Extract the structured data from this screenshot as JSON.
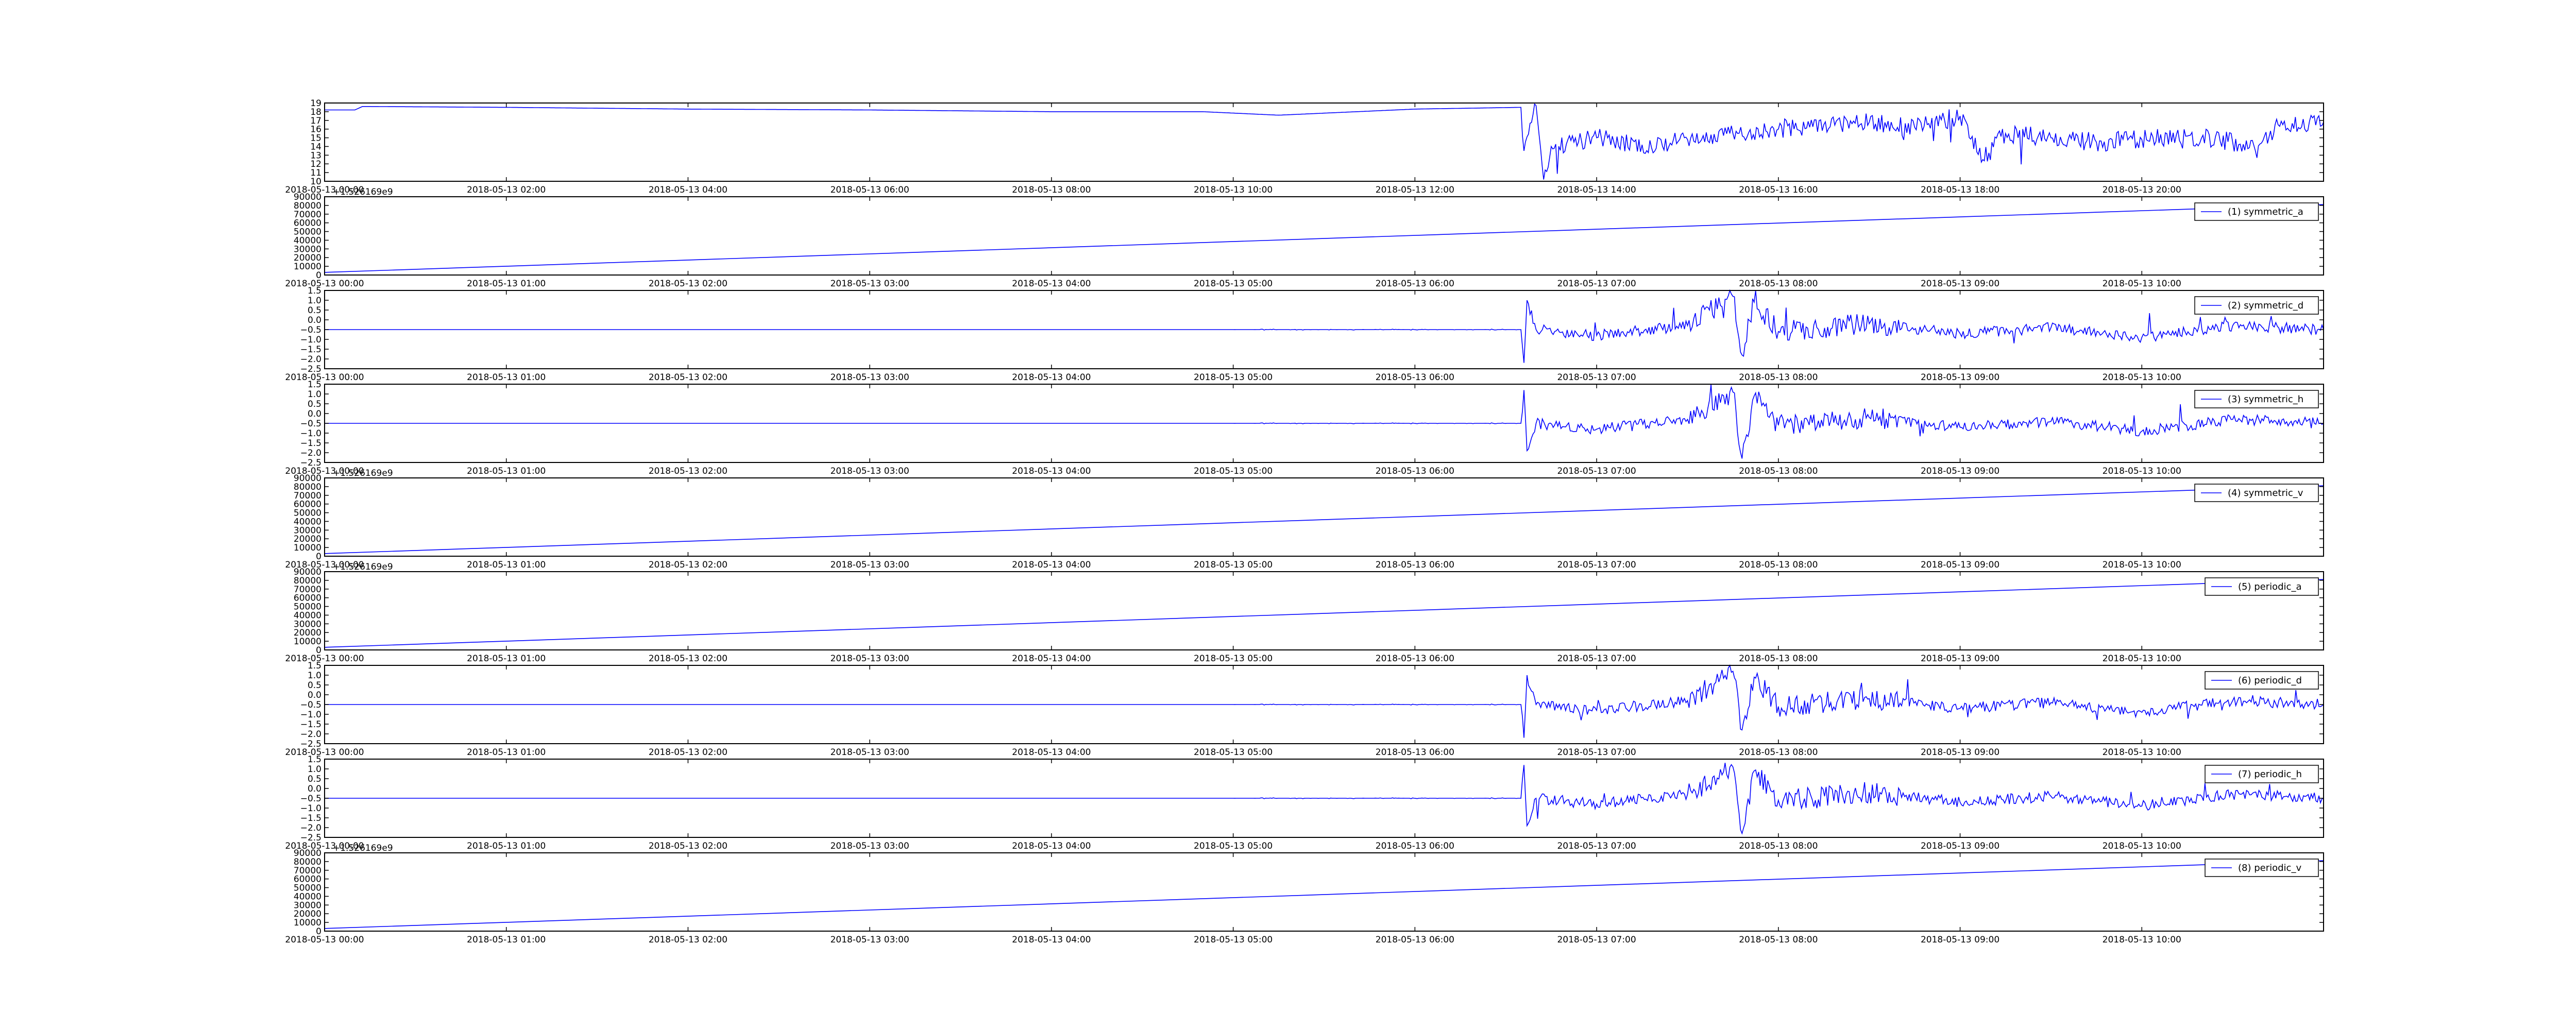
{
  "colors": {
    "line": "#0000ff",
    "axes": "#000000",
    "background": "#ffffff"
  },
  "chart_data": [
    {
      "type": "line",
      "x_tick_labels": [
        "2018-05-13 00:00",
        "2018-05-13 02:00",
        "2018-05-13 04:00",
        "2018-05-13 06:00",
        "2018-05-13 08:00",
        "2018-05-13 10:00",
        "2018-05-13 12:00",
        "2018-05-13 14:00",
        "2018-05-13 16:00",
        "2018-05-13 18:00",
        "2018-05-13 20:00"
      ],
      "x_range": [
        "2018-05-13 00:00",
        "2018-05-13 22:00"
      ],
      "y_tick_labels": [
        "10",
        "11",
        "12",
        "13",
        "14",
        "15",
        "16",
        "17",
        "18",
        "19"
      ],
      "ylim": [
        10,
        19
      ],
      "legend": null,
      "grid": false,
      "series": [
        {
          "x": [
            "2018-05-13 00:00",
            "2018-05-13 00:20",
            "2018-05-13 00:25",
            "2018-05-13 02:00",
            "2018-05-13 04:00",
            "2018-05-13 06:00",
            "2018-05-13 08:00",
            "2018-05-13 09:40",
            "2018-05-13 10:30",
            "2018-05-13 12:00",
            "2018-05-13 13:10",
            "2018-05-13 13:12",
            "2018-05-13 13:20",
            "2018-05-13 13:25",
            "2018-05-13 13:30",
            "2018-05-13 13:45",
            "2018-05-13 14:00",
            "2018-05-13 14:30",
            "2018-05-13 15:00",
            "2018-05-13 15:30",
            "2018-05-13 16:00",
            "2018-05-13 16:30",
            "2018-05-13 17:00",
            "2018-05-13 17:30",
            "2018-05-13 18:00",
            "2018-05-13 18:15",
            "2018-05-13 18:30",
            "2018-05-13 19:00",
            "2018-05-13 19:30",
            "2018-05-13 20:00",
            "2018-05-13 20:30",
            "2018-05-13 21:00",
            "2018-05-13 21:15",
            "2018-05-13 21:30",
            "2018-05-13 22:00"
          ],
          "values": [
            18.2,
            18.2,
            18.6,
            18.5,
            18.3,
            18.2,
            18.0,
            18.0,
            17.6,
            18.3,
            18.5,
            13.5,
            18.7,
            10.2,
            14.0,
            14.5,
            15.0,
            14.2,
            14.8,
            15.5,
            16.0,
            16.5,
            16.8,
            16.2,
            17.5,
            12.5,
            15.5,
            15.0,
            14.5,
            14.8,
            15.2,
            14.5,
            13.5,
            16.5,
            16.8
          ]
        }
      ]
    },
    {
      "type": "line",
      "offset_label": "+1.526169e9",
      "x_tick_labels": [
        "2018-05-13 00:00",
        "2018-05-13 01:00",
        "2018-05-13 02:00",
        "2018-05-13 03:00",
        "2018-05-13 04:00",
        "2018-05-13 05:00",
        "2018-05-13 06:00",
        "2018-05-13 07:00",
        "2018-05-13 08:00",
        "2018-05-13 09:00",
        "2018-05-13 10:00"
      ],
      "x_range": [
        "2018-05-13 00:00",
        "2018-05-13 11:00"
      ],
      "y_tick_labels": [
        "0",
        "10000",
        "20000",
        "30000",
        "40000",
        "50000",
        "60000",
        "70000",
        "80000",
        "90000"
      ],
      "ylim": [
        0,
        90000
      ],
      "legend": "top-right",
      "grid": false,
      "series": [
        {
          "name": "(1) symmetric_a",
          "x": [
            "2018-05-13 00:00",
            "2018-05-13 11:00"
          ],
          "values": [
            3000,
            81000
          ]
        }
      ]
    },
    {
      "type": "line",
      "x_tick_labels": [
        "2018-05-13 00:00",
        "2018-05-13 01:00",
        "2018-05-13 02:00",
        "2018-05-13 03:00",
        "2018-05-13 04:00",
        "2018-05-13 05:00",
        "2018-05-13 06:00",
        "2018-05-13 07:00",
        "2018-05-13 08:00",
        "2018-05-13 09:00",
        "2018-05-13 10:00"
      ],
      "x_range": [
        "2018-05-13 00:00",
        "2018-05-13 11:00"
      ],
      "y_tick_labels": [
        "−2.5",
        "−2.0",
        "−1.5",
        "−1.0",
        "−0.5",
        "0.0",
        "0.5",
        "1.0",
        "1.5"
      ],
      "ylim": [
        -2.5,
        1.5
      ],
      "legend": "top-right",
      "grid": false,
      "series": [
        {
          "name": "(2) symmetric_d",
          "x": [
            "2018-05-13 00:00",
            "2018-05-13 05:00",
            "2018-05-13 06:35",
            "2018-05-13 06:36",
            "2018-05-13 06:37",
            "2018-05-13 06:40",
            "2018-05-13 07:00",
            "2018-05-13 07:30",
            "2018-05-13 07:45",
            "2018-05-13 07:48",
            "2018-05-13 07:52",
            "2018-05-13 08:00",
            "2018-05-13 08:30",
            "2018-05-13 09:00",
            "2018-05-13 09:30",
            "2018-05-13 10:00",
            "2018-05-13 10:30",
            "2018-05-13 11:00"
          ],
          "values": [
            -0.5,
            -0.5,
            -0.5,
            -2.2,
            1.0,
            -0.5,
            -0.8,
            -0.3,
            1.2,
            -1.8,
            0.9,
            -0.6,
            -0.2,
            -0.7,
            -0.4,
            -0.9,
            -0.3,
            -0.5
          ]
        }
      ]
    },
    {
      "type": "line",
      "x_tick_labels": [
        "2018-05-13 00:00",
        "2018-05-13 01:00",
        "2018-05-13 02:00",
        "2018-05-13 03:00",
        "2018-05-13 04:00",
        "2018-05-13 05:00",
        "2018-05-13 06:00",
        "2018-05-13 07:00",
        "2018-05-13 08:00",
        "2018-05-13 09:00",
        "2018-05-13 10:00"
      ],
      "x_range": [
        "2018-05-13 00:00",
        "2018-05-13 11:00"
      ],
      "y_tick_labels": [
        "−2.5",
        "−2.0",
        "−1.5",
        "−1.0",
        "−0.5",
        "0.0",
        "0.5",
        "1.0",
        "1.5"
      ],
      "ylim": [
        -2.5,
        1.5
      ],
      "legend": "top-right",
      "grid": false,
      "series": [
        {
          "name": "(3) symmetric_h",
          "x": [
            "2018-05-13 00:00",
            "2018-05-13 05:00",
            "2018-05-13 06:35",
            "2018-05-13 06:36",
            "2018-05-13 06:37",
            "2018-05-13 06:40",
            "2018-05-13 07:00",
            "2018-05-13 07:30",
            "2018-05-13 07:45",
            "2018-05-13 07:48",
            "2018-05-13 07:52",
            "2018-05-13 08:00",
            "2018-05-13 08:30",
            "2018-05-13 09:00",
            "2018-05-13 09:30",
            "2018-05-13 10:00",
            "2018-05-13 10:30",
            "2018-05-13 11:00"
          ],
          "values": [
            -0.5,
            -0.5,
            -0.5,
            1.2,
            -1.9,
            -0.5,
            -0.8,
            -0.3,
            1.1,
            -2.3,
            0.9,
            -0.6,
            -0.2,
            -0.7,
            -0.4,
            -0.9,
            -0.3,
            -0.5
          ]
        }
      ]
    },
    {
      "type": "line",
      "offset_label": "+1.526169e9",
      "x_tick_labels": [
        "2018-05-13 00:00",
        "2018-05-13 01:00",
        "2018-05-13 02:00",
        "2018-05-13 03:00",
        "2018-05-13 04:00",
        "2018-05-13 05:00",
        "2018-05-13 06:00",
        "2018-05-13 07:00",
        "2018-05-13 08:00",
        "2018-05-13 09:00",
        "2018-05-13 10:00"
      ],
      "x_range": [
        "2018-05-13 00:00",
        "2018-05-13 11:00"
      ],
      "y_tick_labels": [
        "0",
        "10000",
        "20000",
        "30000",
        "40000",
        "50000",
        "60000",
        "70000",
        "80000",
        "90000"
      ],
      "ylim": [
        0,
        90000
      ],
      "legend": "top-right",
      "grid": false,
      "series": [
        {
          "name": "(4) symmetric_v",
          "x": [
            "2018-05-13 00:00",
            "2018-05-13 11:00"
          ],
          "values": [
            3000,
            81000
          ]
        }
      ]
    },
    {
      "type": "line",
      "offset_label": "+1.526169e9",
      "x_tick_labels": [
        "2018-05-13 00:00",
        "2018-05-13 01:00",
        "2018-05-13 02:00",
        "2018-05-13 03:00",
        "2018-05-13 04:00",
        "2018-05-13 05:00",
        "2018-05-13 06:00",
        "2018-05-13 07:00",
        "2018-05-13 08:00",
        "2018-05-13 09:00",
        "2018-05-13 10:00"
      ],
      "x_range": [
        "2018-05-13 00:00",
        "2018-05-13 11:00"
      ],
      "y_tick_labels": [
        "0",
        "10000",
        "20000",
        "30000",
        "40000",
        "50000",
        "60000",
        "70000",
        "80000",
        "90000"
      ],
      "ylim": [
        0,
        90000
      ],
      "legend": "top-right",
      "grid": false,
      "series": [
        {
          "name": "(5) periodic_a",
          "x": [
            "2018-05-13 00:00",
            "2018-05-13 11:00"
          ],
          "values": [
            3000,
            81000
          ]
        }
      ]
    },
    {
      "type": "line",
      "x_tick_labels": [
        "2018-05-13 00:00",
        "2018-05-13 01:00",
        "2018-05-13 02:00",
        "2018-05-13 03:00",
        "2018-05-13 04:00",
        "2018-05-13 05:00",
        "2018-05-13 06:00",
        "2018-05-13 07:00",
        "2018-05-13 08:00",
        "2018-05-13 09:00",
        "2018-05-13 10:00"
      ],
      "x_range": [
        "2018-05-13 00:00",
        "2018-05-13 11:00"
      ],
      "y_tick_labels": [
        "−2.5",
        "−2.0",
        "−1.5",
        "−1.0",
        "−0.5",
        "0.0",
        "0.5",
        "1.0",
        "1.5"
      ],
      "ylim": [
        -2.5,
        1.5
      ],
      "legend": "top-right",
      "grid": false,
      "series": [
        {
          "name": "(6) periodic_d",
          "x": [
            "2018-05-13 00:00",
            "2018-05-13 05:00",
            "2018-05-13 06:35",
            "2018-05-13 06:36",
            "2018-05-13 06:37",
            "2018-05-13 06:40",
            "2018-05-13 07:00",
            "2018-05-13 07:30",
            "2018-05-13 07:45",
            "2018-05-13 07:48",
            "2018-05-13 07:52",
            "2018-05-13 08:00",
            "2018-05-13 08:30",
            "2018-05-13 09:00",
            "2018-05-13 09:30",
            "2018-05-13 10:00",
            "2018-05-13 10:30",
            "2018-05-13 11:00"
          ],
          "values": [
            -0.5,
            -0.5,
            -0.5,
            -2.2,
            1.0,
            -0.5,
            -0.8,
            -0.3,
            1.2,
            -1.8,
            0.9,
            -0.6,
            -0.2,
            -0.7,
            -0.4,
            -0.9,
            -0.3,
            -0.5
          ]
        }
      ]
    },
    {
      "type": "line",
      "x_tick_labels": [
        "2018-05-13 00:00",
        "2018-05-13 01:00",
        "2018-05-13 02:00",
        "2018-05-13 03:00",
        "2018-05-13 04:00",
        "2018-05-13 05:00",
        "2018-05-13 06:00",
        "2018-05-13 07:00",
        "2018-05-13 08:00",
        "2018-05-13 09:00",
        "2018-05-13 10:00"
      ],
      "x_range": [
        "2018-05-13 00:00",
        "2018-05-13 11:00"
      ],
      "y_tick_labels": [
        "−2.5",
        "−2.0",
        "−1.5",
        "−1.0",
        "−0.5",
        "0.0",
        "0.5",
        "1.0",
        "1.5"
      ],
      "ylim": [
        -2.5,
        1.5
      ],
      "legend": "top-right",
      "grid": false,
      "series": [
        {
          "name": "(7) periodic_h",
          "x": [
            "2018-05-13 00:00",
            "2018-05-13 05:00",
            "2018-05-13 06:35",
            "2018-05-13 06:36",
            "2018-05-13 06:37",
            "2018-05-13 06:40",
            "2018-05-13 07:00",
            "2018-05-13 07:30",
            "2018-05-13 07:45",
            "2018-05-13 07:48",
            "2018-05-13 07:52",
            "2018-05-13 08:00",
            "2018-05-13 08:30",
            "2018-05-13 09:00",
            "2018-05-13 09:30",
            "2018-05-13 10:00",
            "2018-05-13 10:30",
            "2018-05-13 11:00"
          ],
          "values": [
            -0.5,
            -0.5,
            -0.5,
            1.2,
            -1.9,
            -0.5,
            -0.8,
            -0.3,
            1.1,
            -2.3,
            0.9,
            -0.6,
            -0.2,
            -0.7,
            -0.4,
            -0.9,
            -0.3,
            -0.5
          ]
        }
      ]
    },
    {
      "type": "line",
      "offset_label": "+1.526169e9",
      "x_tick_labels": [
        "2018-05-13 00:00",
        "2018-05-13 01:00",
        "2018-05-13 02:00",
        "2018-05-13 03:00",
        "2018-05-13 04:00",
        "2018-05-13 05:00",
        "2018-05-13 06:00",
        "2018-05-13 07:00",
        "2018-05-13 08:00",
        "2018-05-13 09:00",
        "2018-05-13 10:00"
      ],
      "x_range": [
        "2018-05-13 00:00",
        "2018-05-13 11:00"
      ],
      "y_tick_labels": [
        "0",
        "10000",
        "20000",
        "30000",
        "40000",
        "50000",
        "60000",
        "70000",
        "80000",
        "90000"
      ],
      "ylim": [
        0,
        90000
      ],
      "legend": "top-right",
      "grid": false,
      "series": [
        {
          "name": "(8) periodic_v",
          "x": [
            "2018-05-13 00:00",
            "2018-05-13 11:00"
          ],
          "values": [
            3000,
            81000
          ]
        }
      ]
    }
  ]
}
